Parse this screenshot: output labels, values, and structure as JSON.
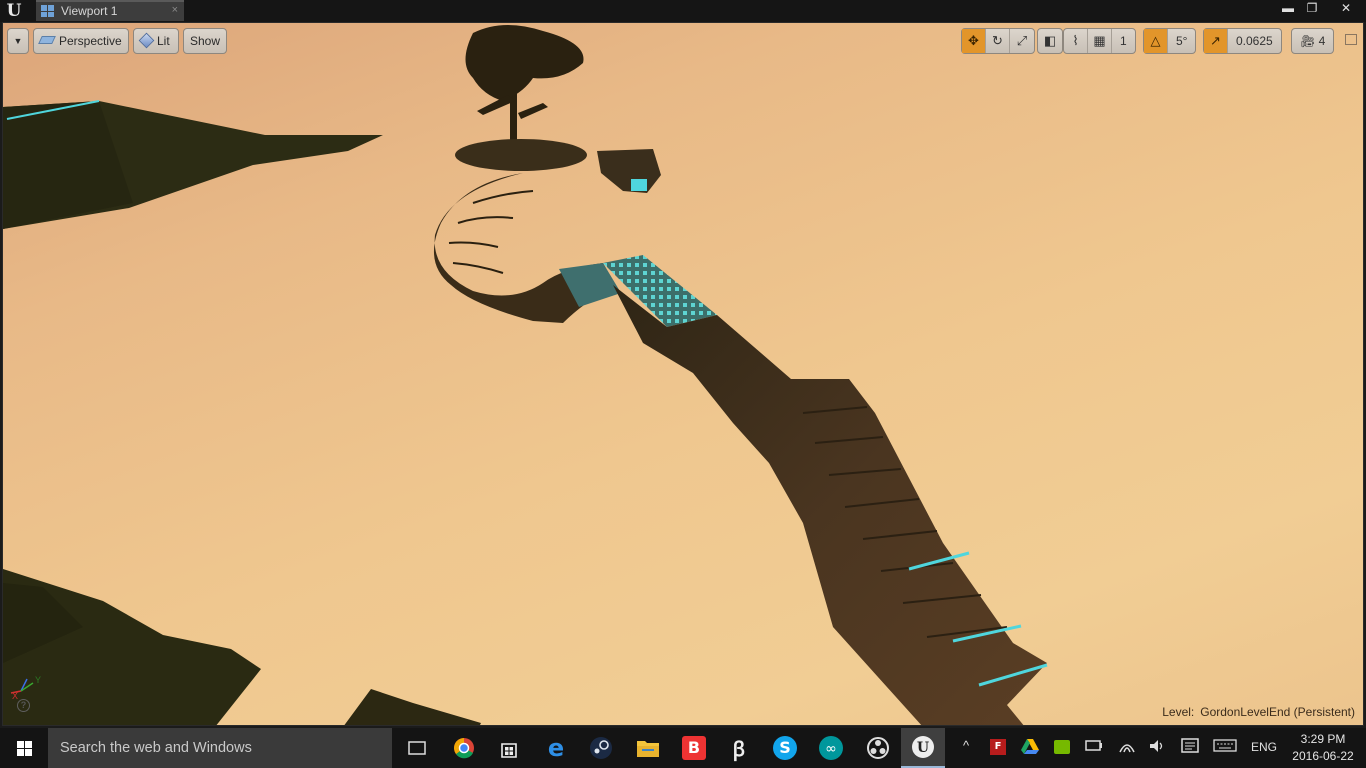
{
  "window": {
    "tab_title": "Viewport 1",
    "tab_close": "×",
    "app_logo": "U",
    "controls": {
      "minimize": "▬",
      "maximize": "❐",
      "close": "✕"
    }
  },
  "viewport_toolbar": {
    "menu_arrow": "▼",
    "perspective_label": "Perspective",
    "lit_label": "Lit",
    "show_label": "Show",
    "transform_icons": [
      "move-icon",
      "rotate-icon",
      "scale-icon"
    ],
    "surface_snap_icon": "cube-icon",
    "grid_snap": {
      "icon": "grid-icon",
      "value": "1"
    },
    "rotation_snap": {
      "icon": "angle-icon",
      "value": "5°"
    },
    "scale_snap": {
      "icon": "scale-arrow-icon",
      "value": "0.0625"
    },
    "camera_speed": {
      "icon": "camera-icon",
      "value": "4"
    },
    "accent_color": "#e2952a"
  },
  "viewport": {
    "level_prefix": "Level:",
    "level_name": "GordonLevelEnd (Persistent)",
    "axis": {
      "x": "X",
      "y": "Y"
    },
    "help_glyph": "?",
    "sky_color": "#efc78f",
    "geometry_color": "#3b2b18",
    "highlight_color": "#4fd6dd"
  },
  "taskbar": {
    "search_placeholder": "Search the web and Windows",
    "apps": [
      "task-view",
      "chrome",
      "store",
      "edge",
      "steam",
      "file-explorer",
      "bandicam",
      "itunes",
      "skype",
      "arduino",
      "obs",
      "unreal-engine"
    ],
    "language": "ENG",
    "time": "3:29 PM",
    "date": "2016-06-22",
    "tray_caret": "^"
  }
}
